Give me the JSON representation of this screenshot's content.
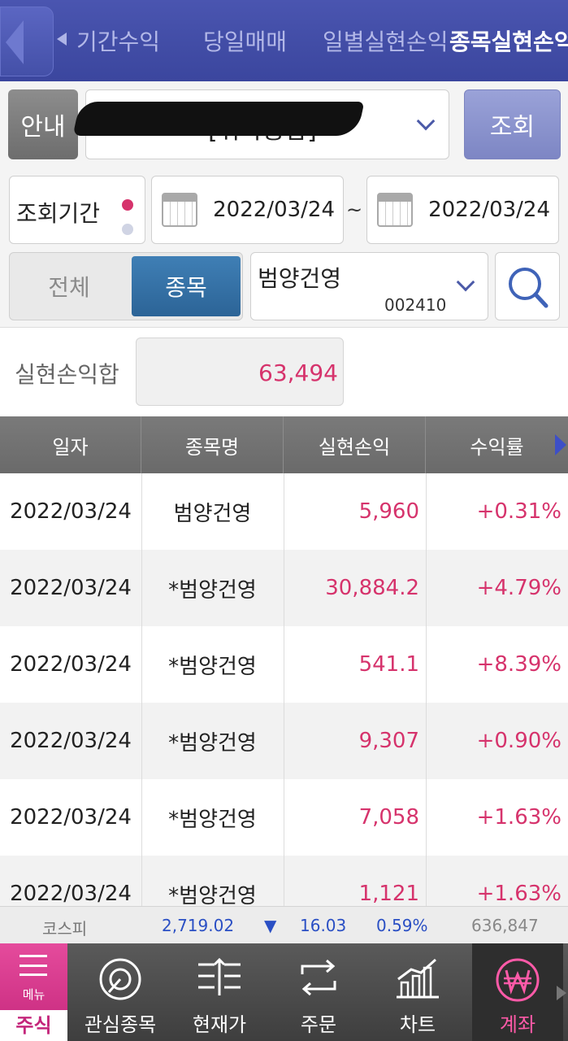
{
  "tabs": [
    {
      "label": "기간수익",
      "active": false
    },
    {
      "label": "당일매매",
      "active": false
    },
    {
      "label": "일별실현손익",
      "active": false
    },
    {
      "label": "종목실현손익",
      "active": true
    }
  ],
  "account": {
    "guide_label": "안내",
    "account_text": "[위탁종합]",
    "query_label": "조회"
  },
  "period": {
    "label": "조회기간",
    "start_date": "2022/03/24",
    "separator": "~",
    "end_date": "2022/03/24"
  },
  "filter": {
    "all_label": "전체",
    "item_label": "종목",
    "stock_name": "범양건영",
    "stock_code": "002410"
  },
  "summary": {
    "label": "실현손익합",
    "value": "63,494"
  },
  "table": {
    "headers": [
      "일자",
      "종목명",
      "실현손익",
      "수익률"
    ],
    "rows": [
      {
        "date": "2022/03/24",
        "name": "범양건영",
        "pl": "5,960",
        "rate": "+0.31%"
      },
      {
        "date": "2022/03/24",
        "name": "*범양건영",
        "pl": "30,884.2",
        "rate": "+4.79%"
      },
      {
        "date": "2022/03/24",
        "name": "*범양건영",
        "pl": "541.1",
        "rate": "+8.39%"
      },
      {
        "date": "2022/03/24",
        "name": "*범양건영",
        "pl": "9,307",
        "rate": "+0.90%"
      },
      {
        "date": "2022/03/24",
        "name": "*범양건영",
        "pl": "7,058",
        "rate": "+1.63%"
      },
      {
        "date": "2022/03/24",
        "name": "*범양건영",
        "pl": "1,121",
        "rate": "+1.63%"
      }
    ]
  },
  "ticker": {
    "index_name": "코스피",
    "index_value": "2,719.02",
    "change_arrow": "▼",
    "change": "16.03",
    "change_pct": "0.59%",
    "volume": "636,847"
  },
  "bottom_nav": {
    "menu_label": "메뉴",
    "stock_label": "주식",
    "items": [
      {
        "label": "관심종목",
        "icon": "watchlist-icon"
      },
      {
        "label": "현재가",
        "icon": "current-price-icon"
      },
      {
        "label": "주문",
        "icon": "order-icon"
      },
      {
        "label": "차트",
        "icon": "chart-icon"
      },
      {
        "label": "계좌",
        "icon": "won-account-icon"
      }
    ]
  },
  "colors": {
    "header_bg": "#3b469e",
    "profit_red": "#d6336c",
    "selected_blue": "#2c6497",
    "ticker_blue": "#2a4fc4",
    "menu_pink": "#c4267b"
  }
}
